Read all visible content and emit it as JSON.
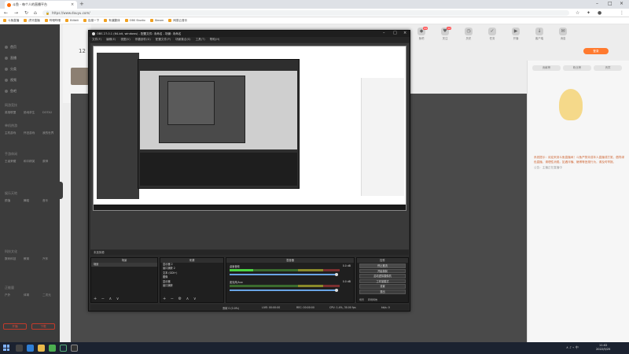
{
  "browser": {
    "tab_title": "斗鱼 - 每个人的直播平台",
    "url": "https://www.douyu.com/",
    "bookmarks": [
      "斗鱼直播",
      "虎牙直播",
      "哔哩哔哩",
      "Bilibili",
      "百度一下",
      "有道翻译",
      "OBS Studio",
      "Steam",
      "网易云音乐"
    ],
    "icons": {
      "back": "back-arrow-icon",
      "forward": "forward-arrow-icon",
      "reload": "reload-icon",
      "home": "home-icon",
      "star": "star-icon",
      "extensions": "puzzle-icon",
      "menu": "kebab-menu-icon"
    }
  },
  "site": {
    "left_nav": {
      "items": [
        "首页",
        "直播",
        "分类",
        "视频",
        "鱼吧"
      ],
      "sections": [
        "网游竞技",
        "单机热游",
        "手游休闲",
        "娱乐天地",
        "科技文化",
        "正能量"
      ],
      "categories": [
        [
          "英雄联盟",
          "绝地求生",
          "DOTA2"
        ],
        [
          "主机游戏",
          "怀旧游戏",
          "我的世界"
        ],
        [
          "王者荣耀",
          "和平精英",
          "原神"
        ],
        [
          "颜值",
          "舞蹈",
          "音乐"
        ],
        [
          "数码科技",
          "教育",
          "汽车"
        ],
        [
          "户外",
          "体育",
          "二次元"
        ]
      ],
      "buttons": [
        "开播",
        "下载"
      ]
    },
    "strip_count": "12",
    "top_icons": [
      {
        "label": "鱼吧",
        "badge": "99"
      },
      {
        "label": "关注",
        "badge": "12"
      },
      {
        "label": "历史",
        "badge": ""
      },
      {
        "label": "任务",
        "badge": ""
      },
      {
        "label": "开播",
        "badge": ""
      },
      {
        "label": "客户端",
        "badge": ""
      },
      {
        "label": "消息",
        "badge": ""
      }
    ],
    "login_label": "登录",
    "right_panel": {
      "ranks": [
        "贡献榜",
        "粉丝榜",
        "贵宾"
      ],
      "notice": "系统提示：欢迎来到斗鱼直播间！斗鱼严禁未成年人直播或打赏，倡导绿色直播，请理性消费。如遇诈骗、赌博等违规行为，请及时举报。",
      "notice_sub": "公告：主播正在直播中"
    }
  },
  "obs": {
    "title": "OBS 27.0.1 (64-bit, windows) - 配置文件: 未命名 - 场景: 未命名",
    "menu": [
      "文件(F)",
      "编辑(E)",
      "视图(V)",
      "停靠部件(D)",
      "配置文件(P)",
      "场景集合(S)",
      "工具(T)",
      "帮助(H)"
    ],
    "status_tab": "未选择源",
    "docks": {
      "scenes": {
        "title": "场景",
        "items": [
          "场景"
        ]
      },
      "sources": {
        "title": "来源",
        "items": [
          "显示器 2",
          "窗口捕获 2",
          "文本 (GDI+)",
          "图像",
          "显示器",
          "窗口捕获"
        ]
      },
      "mixer": {
        "title": "混音器",
        "channels": [
          {
            "name": "桌面音频",
            "db": "0.0 dB"
          },
          {
            "name": "麦克风/Aux",
            "db": "0.0 dB"
          }
        ]
      },
      "controls": {
        "title": "控件",
        "buttons": [
          "停止推流",
          "开始录制",
          "启动虚拟摄像机",
          "工作室模式",
          "设置",
          "退出"
        ],
        "transition_labels": [
          "场景",
          "转场特效"
        ]
      }
    },
    "status": {
      "dropped": "丢帧 0 (0.0%)",
      "live": "LIVE: 00:00:00",
      "rec": "REC: 00:00:00",
      "cpu": "CPU: 1.4%, 30.00 fps",
      "kbps": "kb/s: 0"
    }
  },
  "taskbar": {
    "time": "11:02",
    "date": "2022/5/25"
  }
}
